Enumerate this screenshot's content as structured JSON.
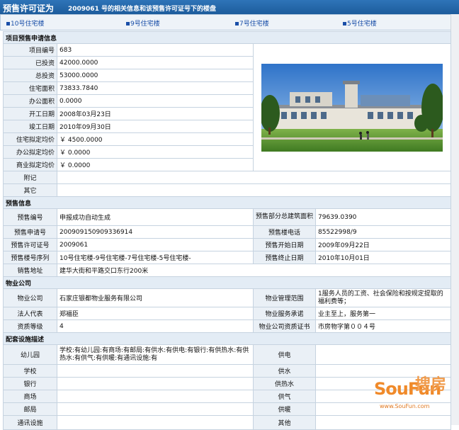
{
  "header": {
    "title": "预售许可证为",
    "subtitle": "2009061 号的相关信息和该预售许可证号下的楼盘"
  },
  "tabs": [
    "10号住宅楼",
    "9号住宅楼",
    "7号住宅楼",
    "5号住宅楼"
  ],
  "project": {
    "section": "项目预售申请信息",
    "rows": [
      {
        "label": "项目编号",
        "value": "683"
      },
      {
        "label": "已投资",
        "value": "42000.0000"
      },
      {
        "label": "总投资",
        "value": "53000.0000"
      },
      {
        "label": "住宅面积",
        "value": "73833.7840"
      },
      {
        "label": "办公面积",
        "value": "0.0000"
      },
      {
        "label": "开工日期",
        "value": "2008年03月23日"
      },
      {
        "label": "竣工日期",
        "value": "2010年09月30日"
      },
      {
        "label": "住宅拟定均价",
        "value": "￥ 4500.0000"
      },
      {
        "label": "办公拟定均价",
        "value": "￥ 0.0000"
      },
      {
        "label": "商业拟定均价",
        "value": "￥ 0.0000"
      }
    ],
    "notes_label": "附记",
    "notes_value": "",
    "other_label": "其它",
    "other_value": ""
  },
  "presale": {
    "section": "预售信息",
    "rows": [
      {
        "l1": "预售编号",
        "v1": "申报成功自动生成",
        "l2": "预售部分总建筑面积",
        "v2": "79639.0390"
      },
      {
        "l1": "预售申请号",
        "v1": "200909150909336914",
        "l2": "预售楼电话",
        "v2": "85522998/9"
      },
      {
        "l1": "预售许可证号",
        "v1": "2009061",
        "l2": "预售开始日期",
        "v2": "2009年09月22日"
      },
      {
        "l1": "预售楼号序列",
        "v1": "10号住宅楼-9号住宅楼-7号住宅楼-5号住宅楼-",
        "l2": "预售终止日期",
        "v2": "2010年10月01日"
      }
    ],
    "address_label": "销售地址",
    "address_value": "建华大街和平路交口东行200米"
  },
  "property": {
    "section": "物业公司",
    "rows": [
      {
        "l1": "物业公司",
        "v1": "石家庄银都物业服务有限公司",
        "l2": "物业管理范围",
        "v2": "1服务人员的工资、社会保险和按规定提取的福利费等；"
      },
      {
        "l1": "法人代表",
        "v1": "郑福臣",
        "l2": "物业服务承诺",
        "v2": "业主至上，服务第一"
      },
      {
        "l1": "资质等级",
        "v1": "4",
        "l2": "物业公司资质证书",
        "v2": "市房物字第００４号"
      }
    ]
  },
  "facilities": {
    "section": "配套设施描述",
    "rows": [
      {
        "l1": "幼儿园",
        "v1": "学校:有幼儿园:有商场:有邮局:有供水:有供电:有银行:有供热水:有供热水:有供气:有供暖:有通讯设施:有",
        "l2": "供电",
        "v2": ""
      },
      {
        "l1": "学校",
        "v1": "",
        "l2": "供水",
        "v2": ""
      },
      {
        "l1": "银行",
        "v1": "",
        "l2": "供热水",
        "v2": ""
      },
      {
        "l1": "商场",
        "v1": "",
        "l2": "供气",
        "v2": ""
      },
      {
        "l1": "邮局",
        "v1": "",
        "l2": "供暖",
        "v2": ""
      },
      {
        "l1": "通讯设施",
        "v1": "",
        "l2": "其他",
        "v2": ""
      }
    ]
  },
  "watermark": {
    "brand_latin": "SouFun",
    "brand_cn": "搜房",
    "url": "www.SouFun.com"
  },
  "colors": {
    "header_bg": "#1d5c9c",
    "label_bg": "#eaf0f6",
    "border": "#c6d3e0",
    "tab_link": "#1a4fa8",
    "watermark": "#f08a2a"
  }
}
